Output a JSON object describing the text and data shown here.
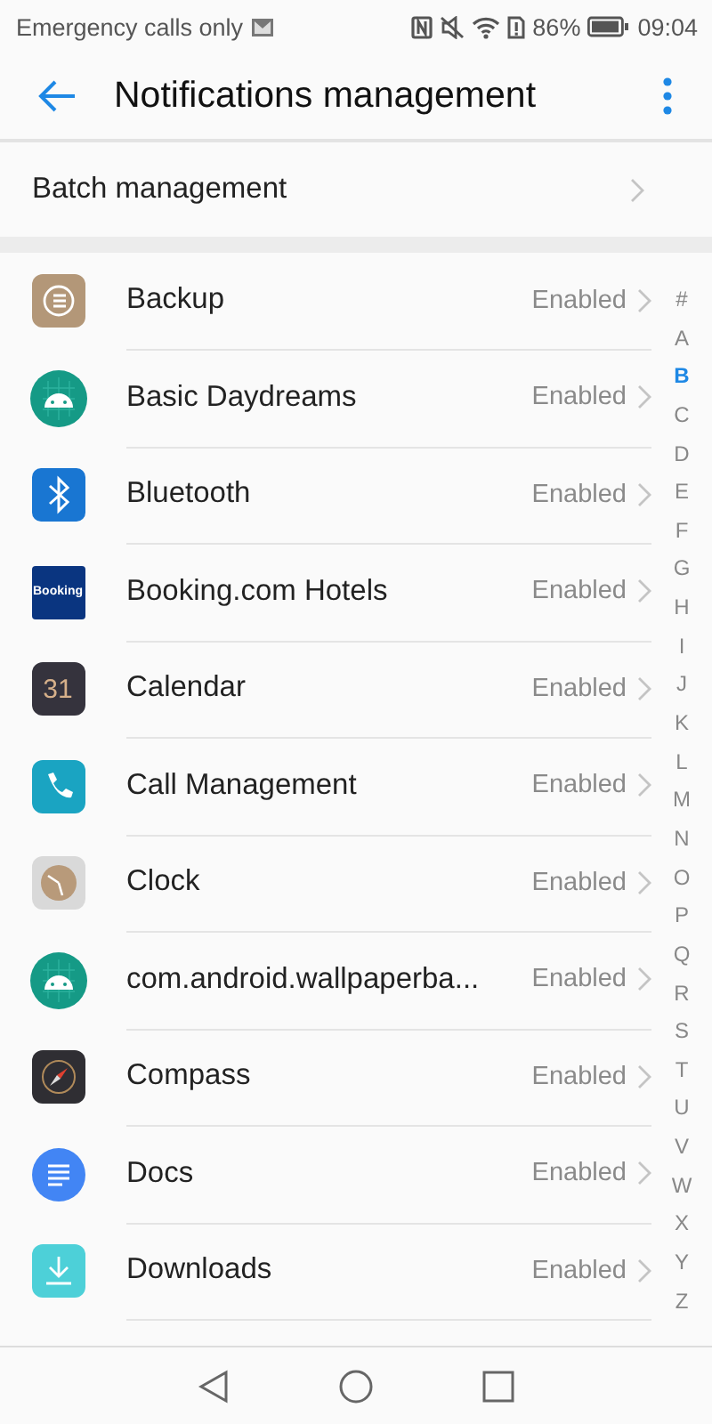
{
  "status_bar": {
    "carrier": "Emergency calls only",
    "battery": "86%",
    "time": "09:04"
  },
  "app_bar": {
    "title": "Notifications management"
  },
  "batch": {
    "label": "Batch management"
  },
  "apps": [
    {
      "name": "Backup",
      "status": "Enabled",
      "kind": "backup"
    },
    {
      "name": "Basic Daydreams",
      "status": "Enabled",
      "kind": "android"
    },
    {
      "name": "Bluetooth",
      "status": "Enabled",
      "kind": "bluetooth"
    },
    {
      "name": "Booking.com Hotels",
      "status": "Enabled",
      "kind": "booking",
      "icon_text": "Booking"
    },
    {
      "name": "Calendar",
      "status": "Enabled",
      "kind": "calendar",
      "icon_text": "31"
    },
    {
      "name": "Call Management",
      "status": "Enabled",
      "kind": "phone"
    },
    {
      "name": "Clock",
      "status": "Enabled",
      "kind": "clock"
    },
    {
      "name": "com.android.wallpaperba...",
      "status": "Enabled",
      "kind": "android"
    },
    {
      "name": "Compass",
      "status": "Enabled",
      "kind": "compass"
    },
    {
      "name": "Docs",
      "status": "Enabled",
      "kind": "docs"
    },
    {
      "name": "Downloads",
      "status": "Enabled",
      "kind": "download"
    }
  ],
  "index": [
    {
      "label": "#",
      "selected": false
    },
    {
      "label": "A",
      "selected": false
    },
    {
      "label": "B",
      "selected": true
    },
    {
      "label": "C",
      "selected": false
    },
    {
      "label": "D",
      "selected": false
    },
    {
      "label": "E",
      "selected": false
    },
    {
      "label": "F",
      "selected": false
    },
    {
      "label": "G",
      "selected": false
    },
    {
      "label": "H",
      "selected": false
    },
    {
      "label": "I",
      "selected": false
    },
    {
      "label": "J",
      "selected": false
    },
    {
      "label": "K",
      "selected": false
    },
    {
      "label": "L",
      "selected": false
    },
    {
      "label": "M",
      "selected": false
    },
    {
      "label": "N",
      "selected": false
    },
    {
      "label": "O",
      "selected": false
    },
    {
      "label": "P",
      "selected": false
    },
    {
      "label": "Q",
      "selected": false
    },
    {
      "label": "R",
      "selected": false
    },
    {
      "label": "S",
      "selected": false
    },
    {
      "label": "T",
      "selected": false
    },
    {
      "label": "U",
      "selected": false
    },
    {
      "label": "V",
      "selected": false
    },
    {
      "label": "W",
      "selected": false
    },
    {
      "label": "X",
      "selected": false
    },
    {
      "label": "Y",
      "selected": false
    },
    {
      "label": "Z",
      "selected": false
    }
  ]
}
